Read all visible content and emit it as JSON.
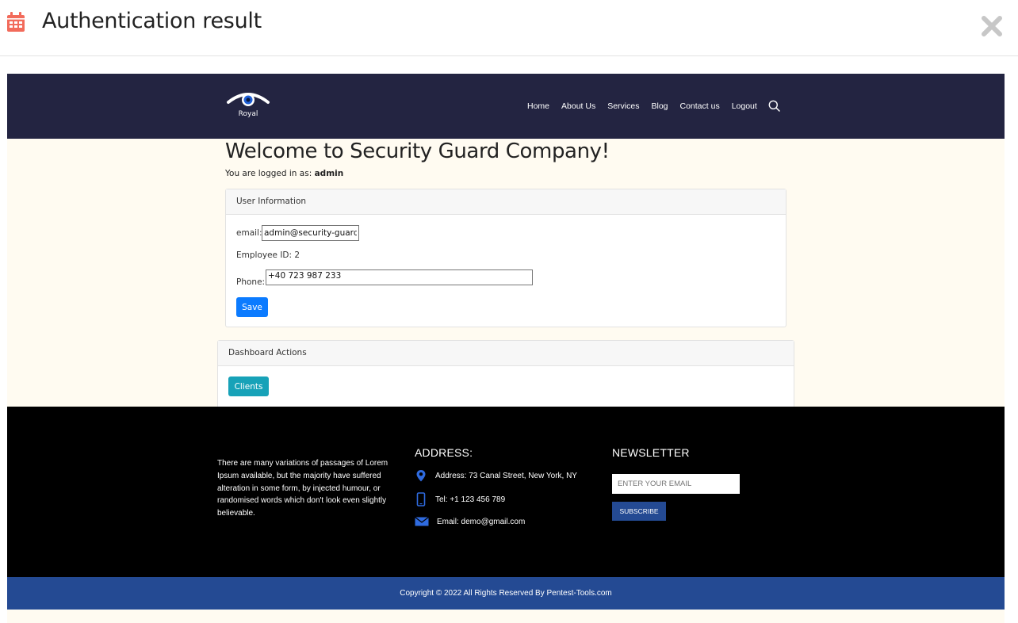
{
  "modal": {
    "title": "Authentication result",
    "icon": "calendar-icon",
    "close_icon": "close-icon",
    "accent_color": "#f26b5b"
  },
  "navbar": {
    "logo_text": "Royal",
    "items": [
      "Home",
      "About Us",
      "Services",
      "Blog",
      "Contact us",
      "Logout"
    ],
    "background": "#232441"
  },
  "main": {
    "heading": "Welcome to Security Guard Company!",
    "logged_prefix": "You are logged in as:",
    "username": "admin"
  },
  "user_info": {
    "title": "User Information",
    "email_label": "email:",
    "email_value": "admin@security-guard.com",
    "employee_id": "Employee ID: 2",
    "phone_label": "Phone:",
    "phone_value": "+40 723 987 233",
    "save_label": "Save"
  },
  "dashboard": {
    "title": "Dashboard Actions",
    "clients_label": "Clients"
  },
  "footer": {
    "about": "There are many variations of passages of Lorem Ipsum available, but the majority have suffered alteration in some form, by injected humour, or randomised words which don't look even slightly believable.",
    "address_title": "ADDRESS:",
    "address": "Address: 73 Canal Street, New York, NY",
    "tel": "Tel: +1 123 456 789",
    "email": "Email: demo@gmail.com",
    "newsletter_title": "NEWSLETTER",
    "newsletter_placeholder": "ENTER YOUR EMAIL",
    "subscribe_label": "SUBSCRIBE",
    "copyright": "Copyright © 2022 All Rights Reserved By Pentest-Tools.com"
  }
}
